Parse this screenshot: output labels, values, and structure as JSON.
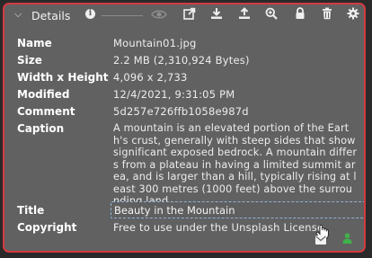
{
  "header": {
    "title": "Details",
    "info_icon": "i",
    "tools": [
      "eye-icon",
      "open-external-icon",
      "download-icon",
      "upload-icon",
      "zoom-icon",
      "lock-icon",
      "trash-icon",
      "gear-icon"
    ]
  },
  "details": {
    "name": {
      "label": "Name",
      "value": "Mountain01.jpg"
    },
    "size": {
      "label": "Size",
      "value": "2.2 MB (2,310,924 Bytes)"
    },
    "dimensions": {
      "label": "Width x Height",
      "value": "4,096 x 2,733"
    },
    "modified": {
      "label": "Modified",
      "value": "12/4/2021, 9:31:05 PM"
    },
    "comment": {
      "label": "Comment",
      "value": "5d257e726ffb1058e987d"
    },
    "caption": {
      "label": "Caption",
      "value": "A mountain is an elevated portion of the Earth's crust, generally with steep sides that show significant exposed bedrock. A mountain differs from a plateau in having a limited summit area, and is larger than a hill, typically rising at least 300 metres (1000 feet) above the surrounding land."
    },
    "title": {
      "label": "Title",
      "value": "Beauty in the Mountain"
    },
    "copyright": {
      "label": "Copyright",
      "value": "Free to use under the Unsplash License"
    }
  },
  "footer": {
    "icons": [
      "mail-icon",
      "user-icon"
    ],
    "user_color": "#3fb24a"
  },
  "colors": {
    "panel_bg": "#616161",
    "border": "#d23a3f"
  }
}
